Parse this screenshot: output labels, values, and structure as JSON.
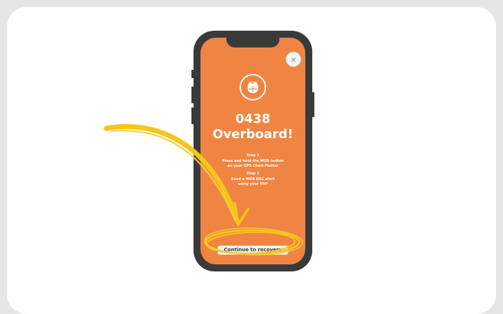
{
  "alert": {
    "title_line1": "0438",
    "title_line2": "Overboard!",
    "steps": [
      {
        "label": "Step 1",
        "text_line1": "Press and hold the MOB button",
        "text_line2": "on your GPS Chart Plotter"
      },
      {
        "label": "Step 2",
        "text_line1": "Send a MOB DSC alert",
        "text_line2": "using your VHF"
      }
    ],
    "close_icon": "×",
    "cta_label": "Continue to recovery"
  },
  "icons": {
    "close": "close-icon",
    "badge": "lifejacket-icon"
  },
  "colors": {
    "screen": "#f08442",
    "annotation": "#f5c518",
    "button": "#f2f2f2",
    "phone_frame": "#3a3a3a"
  }
}
